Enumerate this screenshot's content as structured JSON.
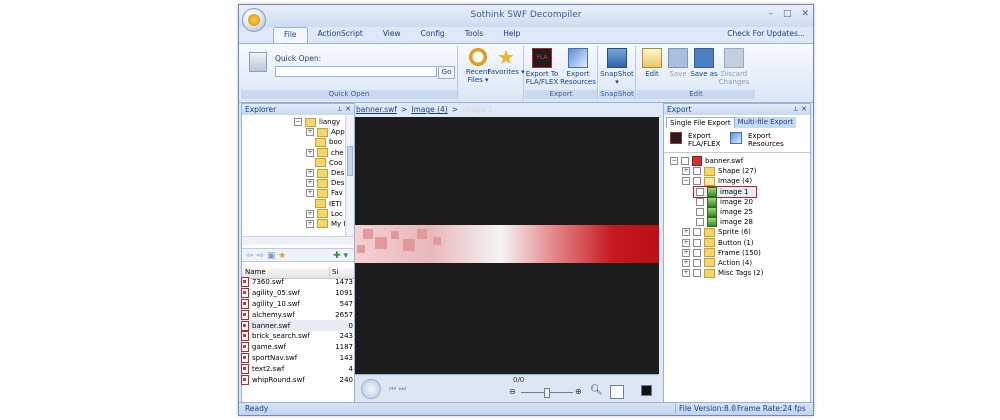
{
  "window": {
    "title": "Sothink SWF Decompiler",
    "controls": [
      "–",
      "□",
      "✕"
    ]
  },
  "menu": {
    "tabs": [
      "File",
      "ActionScript",
      "View",
      "Config",
      "Tools",
      "Help"
    ],
    "check_updates": "Check For Updates..."
  },
  "ribbon": {
    "quick_open": {
      "label": "Quick Open:",
      "go": "Go",
      "group": "Quick Open"
    },
    "recent_files": "Recent Files",
    "favorites": "Favorites",
    "export_fla": "Export To FLA/FLEX",
    "export_resources": "Export Resources",
    "export_group": "Export",
    "snapshot": "SnapShot",
    "snapshot_group": "SnapShot",
    "edit": "Edit",
    "save": "Save",
    "save_as": "Save as",
    "discard": "Discard Changes",
    "edit_group": "Edit"
  },
  "explorer": {
    "title": "Explorer",
    "tree": [
      "liangy",
      "App",
      "boo",
      "che",
      "Coo",
      "Des",
      "Des",
      "Fav",
      "IETI",
      "Loc",
      "My I"
    ],
    "columns": {
      "name": "Name",
      "size": "Si"
    },
    "files": [
      {
        "name": "7360.swf",
        "size": "1473"
      },
      {
        "name": "agility_05.swf",
        "size": "1091"
      },
      {
        "name": "agility_10.swf",
        "size": "547"
      },
      {
        "name": "alchemy.swf",
        "size": "2657"
      },
      {
        "name": "banner.swf",
        "size": "0"
      },
      {
        "name": "brick_search.swf",
        "size": "243"
      },
      {
        "name": "game.swf",
        "size": "1187"
      },
      {
        "name": "sportNav.swf",
        "size": "143"
      },
      {
        "name": "text2.swf",
        "size": "4"
      },
      {
        "name": "whipRound.swf",
        "size": "240"
      }
    ]
  },
  "viewer": {
    "breadcrumb": [
      "banner.swf",
      ">",
      "Image (4)",
      ">",
      "Image 1"
    ],
    "frame_counter": "0/0"
  },
  "export": {
    "title": "Export",
    "tabs": [
      "Single File Export",
      "Multi-file Export"
    ],
    "export_fla": "Export FLA/FLEX",
    "export_resources": "Export Resources",
    "tree": {
      "root": "banner.swf",
      "shape": "Shape (27)",
      "image": "Image (4)",
      "images": [
        "image 1",
        "image 20",
        "image 25",
        "image 28"
      ],
      "sprite": "Sprite (6)",
      "button": "Button (1)",
      "frame": "Frame (150)",
      "action": "Action (4)",
      "misc": "Misc Tags (2)"
    }
  },
  "status": {
    "text": "Ready",
    "file_version": "File Version:8.0",
    "frame_rate": "Frame Rate:24 fps"
  }
}
